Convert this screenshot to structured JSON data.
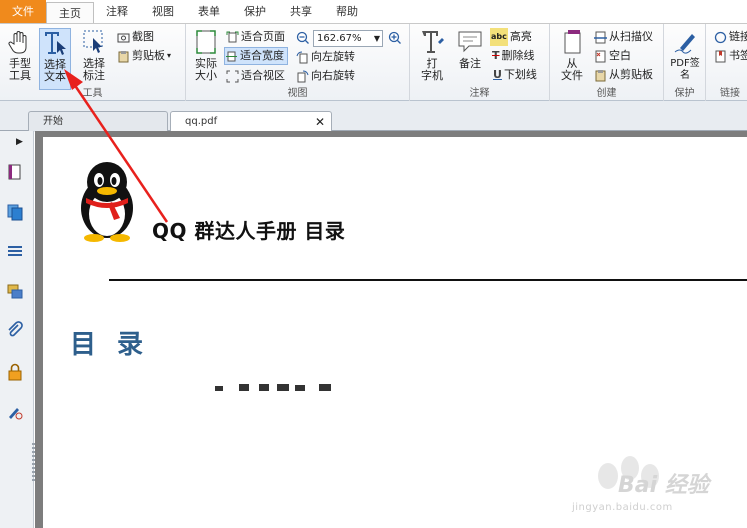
{
  "menu": {
    "items": [
      "文件",
      "主页",
      "注释",
      "视图",
      "表单",
      "保护",
      "共享",
      "帮助"
    ],
    "active": "主页"
  },
  "ribbon": {
    "tools": {
      "label": "工具",
      "hand": "手型\n工具",
      "select_text": "选择\n文本",
      "select_annot": "选择\n标注",
      "snapshot": "截图",
      "clipboard": "剪贴板"
    },
    "view": {
      "label": "视图",
      "actual_size": "实际\n大小",
      "fit_page": "适合页面",
      "fit_width": "适合宽度",
      "fit_visible": "适合视区",
      "zoom_value": "162.67%",
      "rotate_left": "向左旋转",
      "rotate_right": "向右旋转"
    },
    "comment": {
      "label": "注释",
      "typewriter": "打\n字机",
      "note": "备注",
      "highlight": "高亮",
      "strikeout": "删除线",
      "underline": "下划线"
    },
    "create": {
      "label": "创建",
      "from_file": "从\n文件",
      "from_scanner": "从扫描仪",
      "blank": "空白",
      "from_clipboard": "从剪贴板"
    },
    "protect": {
      "label": "保护",
      "pdf_sign": "PDF签\n名"
    },
    "links": {
      "label": "链接",
      "link": "链接",
      "bookmark": "书签"
    }
  },
  "tabs": {
    "home": "开始",
    "doc": "qq.pdf"
  },
  "document": {
    "title": "QQ 群达人手册  目录",
    "toc_heading": "目 录"
  },
  "watermark": {
    "brand": "Bai 经验",
    "url": "jingyan.baidu.com"
  },
  "colors": {
    "file_menu": "#f08a1c",
    "selected": "#cfe3fb",
    "toc_blue": "#2e5f8c",
    "arrow_red": "#e8211d"
  }
}
